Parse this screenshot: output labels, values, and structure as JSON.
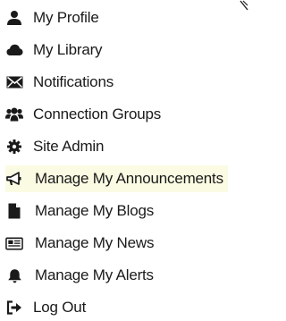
{
  "menu": {
    "items": [
      {
        "label": "My Profile",
        "icon": "user-icon"
      },
      {
        "label": "My Library",
        "icon": "cloud-icon"
      },
      {
        "label": "Notifications",
        "icon": "envelope-icon"
      },
      {
        "label": "Connection Groups",
        "icon": "users-icon"
      },
      {
        "label": "Site Admin",
        "icon": "gear-icon"
      },
      {
        "label": "Manage My Announcements",
        "icon": "megaphone-icon",
        "active": true
      },
      {
        "label": "Manage My Blogs",
        "icon": "document-icon"
      },
      {
        "label": "Manage My News",
        "icon": "newspaper-icon"
      },
      {
        "label": "Manage My Alerts",
        "icon": "bell-icon"
      },
      {
        "label": "Log Out",
        "icon": "logout-icon"
      }
    ]
  },
  "colors": {
    "text": "#1a1a1a",
    "icon": "#1a1a1a",
    "active_bg": "#fbfbe3"
  }
}
